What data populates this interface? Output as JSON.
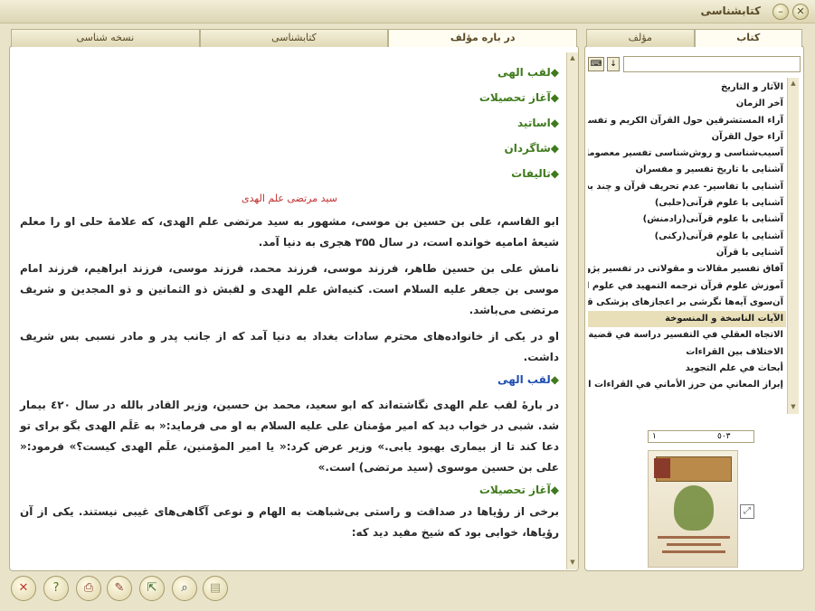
{
  "window": {
    "title": "کتابشناسی"
  },
  "left_tabs": [
    "در باره مؤلف",
    "کتابشناسی",
    "نسخه شناسی"
  ],
  "right_tabs": [
    "مؤلف",
    "کتاب"
  ],
  "content": {
    "sections": [
      "لقب الهی",
      "آغاز تحصیلات",
      "اساتید",
      "شاگردان",
      "تالیفات"
    ],
    "subtitle": "سید مرتضی علم الهدی",
    "paragraphs": [
      "ابو القاسم، علی بن حسین بن موسی، مشهور به سید مرتضی علم الهدی، که علامهٔ حلی او را معلم شیعهٔ امامیه خوانده است، در سال ۳۵۵ هجری به دنیا آمد.",
      "نامش علی بن حسین طاهر، فرزند موسی، فرزند محمد، فرزند موسی، فرزند ابراهیم، فرزند امام موسی بن جعفر علیه السلام است. کنیه‌اش علم الهدی و لقبش ذو الثمانین و ذو المجدین و شریف مرتضی می‌باشد.",
      "او در یکی از خانواده‌های محترم سادات بغداد به دنیا آمد که از جانب پدر و مادر نسبی بس شریف داشت."
    ],
    "section_laqab": "لقب الهی",
    "paragraph_laqab": "در بارهٔ لقب علم الهدی نگاشته‌اند که ابو سعید، محمد بن حسین، وزیر القادر بالله در سال ٤٢٠ بیمار شد. شبی در خواب دید که امیر مؤمنان علی علیه السلام به او می فرماید:« به عَلَم الهدی بگو برای تو دعا کند تا از بیماری بهبود یابی.» وزیر عرض کرد:« یا امیر المؤمنین، علَم الهدی کیست؟» فرمود:« علی بن حسین موسوی (سید مرتضی) است.»",
    "section_aghaz": "آغاز تحصیلات",
    "paragraph_aghaz": "برخی از رؤیاها در صداقت و راستی بی‌شباهت به الهام و نوعی آگاهی‌های غیبی نیستند. یکی از آن رؤیاها، خوابی بود که شیخ مفید دید که:"
  },
  "search": {
    "value": ""
  },
  "books": [
    "الآثار و التاريخ",
    "آخر الزمان",
    "آراء المستشرقين حول القرآن الكريم و تفسيره",
    "آراء حول القرآن",
    "آسیب‌شناسی و روش‌شناسی تفسیر معصومان علیهم ...",
    "آشنایی با تاریخ تفسیر و مفسران",
    "آشنایی با تفاسیر- عدم تحریف قرآن و چند بحث ة ...",
    "آشنایی با علوم قرآنی(حلبی)",
    "آشنایی با علوم قرآنی(رادمنش)",
    "آشنایی با علوم قرآنی(رکنی)",
    "آشنایی با قرآن",
    "آفاق تفسیر مقالات و مقولاتی در تفسیر پژوهی",
    "آموزش علوم قرآن ترجمه التمهيد في علوم القرآن",
    "آن‌سوی آیه‌ها نگرشی بر اعجازهای پزشکی قرآن",
    "الآيات الناسخة و المنسوخة",
    "الاتجاه العقلي في التفسير دراسة في قضية المجاز ة",
    "الاختلاف بين القراءات",
    "أبحاث في علم التجويد",
    "إبراز المعاني من حرز الأماني في القراءات السبع"
  ],
  "selected_book_index": 14,
  "pager": {
    "current": "١",
    "total": "٥٠٣"
  },
  "icons": {
    "minimize": "minimize-icon",
    "close": "close-icon",
    "toolbar": [
      "close-icon",
      "help-icon",
      "print-icon",
      "edit-icon",
      "export-icon",
      "search-icon",
      "notes-icon"
    ]
  }
}
